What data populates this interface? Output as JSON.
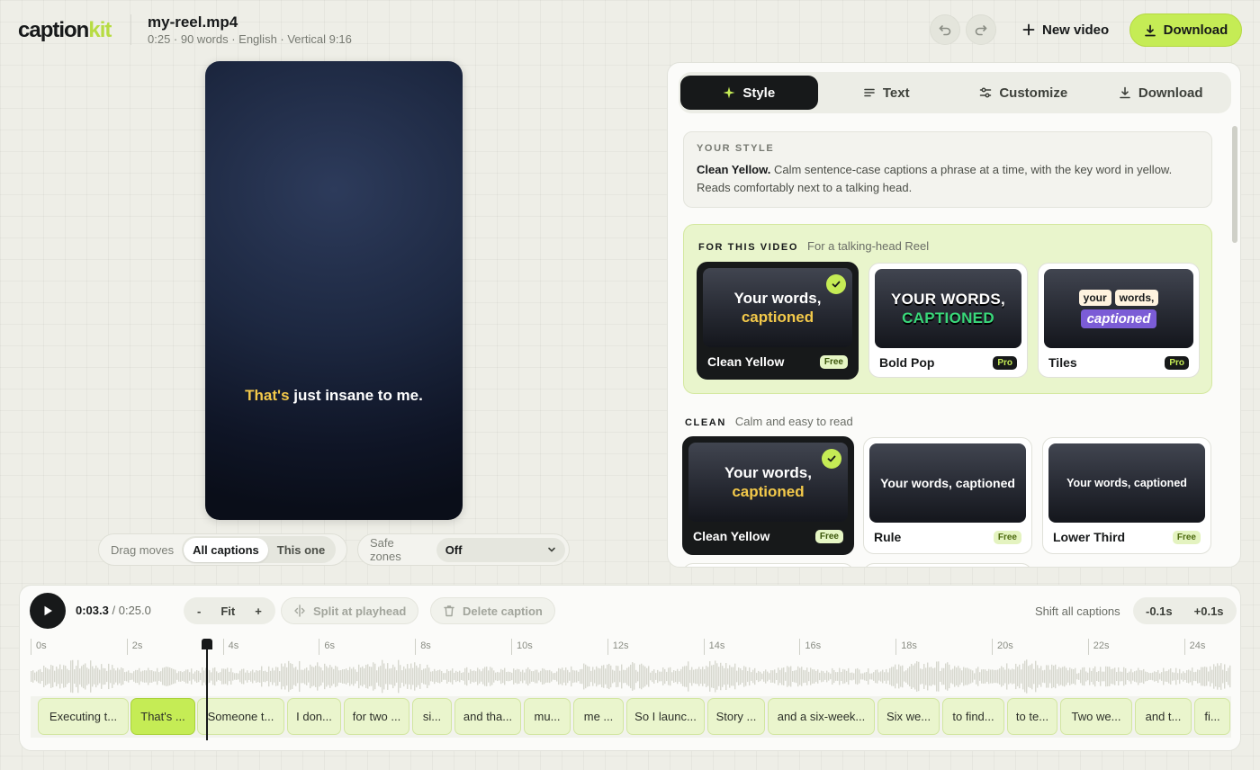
{
  "app": {
    "logo_main": "caption",
    "logo_accent": "kit"
  },
  "file": {
    "name": "my-reel.mp4",
    "meta": "0:25 · 90 words · English · Vertical 9:16"
  },
  "header": {
    "new_video": "New video",
    "download": "Download"
  },
  "preview": {
    "caption_highlight": "That's",
    "caption_rest": " just insane to me."
  },
  "controls": {
    "drag_label": "Drag moves",
    "all_captions": "All captions",
    "this_one": "This one",
    "safe_label": "Safe zones",
    "safe_value": "Off"
  },
  "tabs": [
    "Style",
    "Text",
    "Customize",
    "Download"
  ],
  "your_style": {
    "eyebrow": "YOUR STYLE",
    "name": "Clean Yellow.",
    "desc": " Calm sentence-case captions a phrase at a time, with the key word in yellow. Reads comfortably next to a talking head."
  },
  "for_video": {
    "title": "FOR THIS VIDEO",
    "subtitle": "For a talking-head Reel",
    "cards": [
      {
        "name": "Clean Yellow",
        "badge": "Free",
        "line1": "Your words,",
        "line2": "captioned",
        "selected": true
      },
      {
        "name": "Bold Pop",
        "badge": "Pro",
        "line1": "YOUR WORDS,",
        "line2": "CAPTIONED"
      },
      {
        "name": "Tiles",
        "badge": "Pro",
        "tile1": "your",
        "tile2": "words,",
        "tile3": "captioned"
      }
    ]
  },
  "clean": {
    "title": "CLEAN",
    "subtitle": "Calm and easy to read",
    "cards": [
      {
        "name": "Clean Yellow",
        "badge": "Free",
        "line1": "Your words,",
        "line2": "captioned",
        "selected": true
      },
      {
        "name": "Rule",
        "badge": "Free",
        "text": "Your words, captioned"
      },
      {
        "name": "Lower Third",
        "badge": "Free",
        "text": "Your words, captioned"
      }
    ]
  },
  "timeline": {
    "current": "0:03.3",
    "total": "/ 0:25.0",
    "zoom_minus": "-",
    "zoom_fit": "Fit",
    "zoom_plus": "+",
    "split": "Split at playhead",
    "delete": "Delete caption",
    "shift_label": "Shift all captions",
    "shift_minus": "-0.1s",
    "shift_plus": "+0.1s",
    "ticks": [
      "0s",
      "2s",
      "4s",
      "6s",
      "8s",
      "10s",
      "12s",
      "14s",
      "16s",
      "18s",
      "20s",
      "22s",
      "24s"
    ],
    "playhead_seconds": 3.3,
    "captions": [
      "Executing t...",
      "That's ...",
      "Someone t...",
      "I don...",
      "for two ...",
      "si...",
      "and tha...",
      "mu...",
      "me ...",
      "So I launc...",
      "Story ...",
      "and a six-week...",
      "Six we...",
      "to find...",
      "to te...",
      "Two we...",
      "and t...",
      "fi..."
    ],
    "active_caption": 1
  },
  "colors": {
    "accent": "#c5ec55",
    "highlight": "#f3c94a",
    "dark": "#17191a"
  },
  "icons": [
    "undo-icon",
    "redo-icon",
    "plus-icon",
    "download-icon",
    "sparkle-icon",
    "text-lines-icon",
    "sliders-icon",
    "check-icon",
    "chevron-down-icon",
    "play-icon",
    "split-icon",
    "trash-icon"
  ]
}
